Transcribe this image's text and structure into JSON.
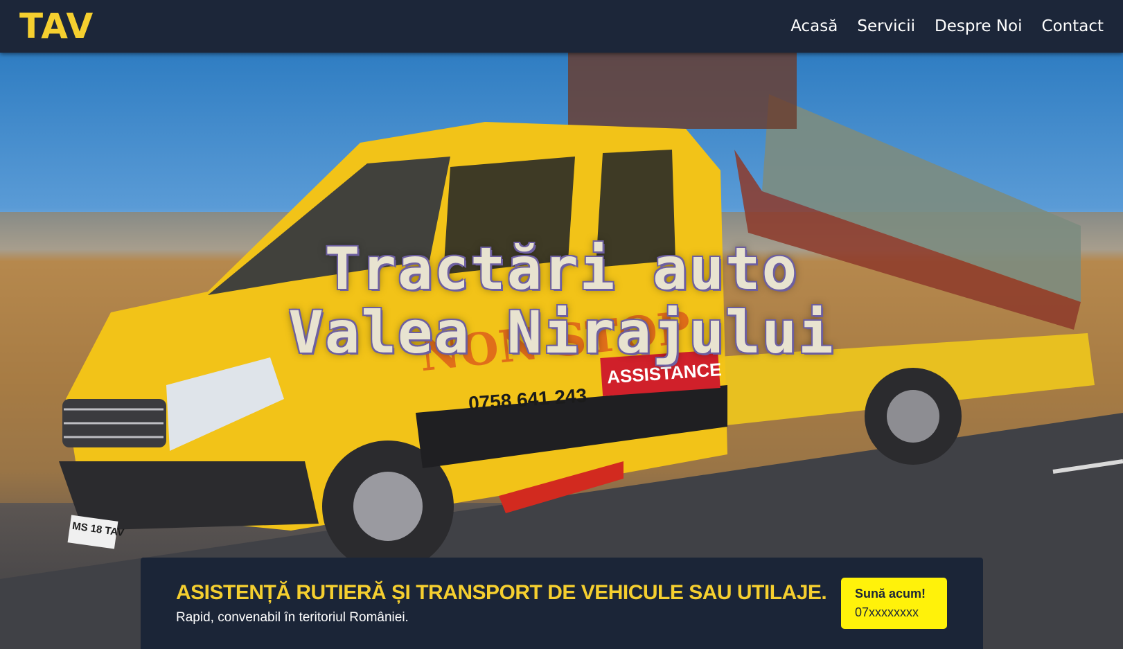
{
  "nav": {
    "logo": "TAV",
    "links": [
      "Acasă",
      "Servicii",
      "Despre Noi",
      "Contact"
    ]
  },
  "hero": {
    "title_line1": "Tractări auto",
    "title_line2": "Valea Nirajului",
    "truck_phone": "0758 641 243",
    "truck_badge": "ASSISTANCE",
    "truck_side_text": "NON STOP",
    "truck_plate": "MS 18 TAV"
  },
  "banner": {
    "headline": "ASISTENȚĂ RUTIERĂ ȘI TRANSPORT DE VEHICULE SAU UTILAJE.",
    "subtitle": "Rapid, convenabil în teritoriul României.",
    "cta_label": "Sună acum!",
    "cta_number": "07xxxxxxxx"
  },
  "colors": {
    "navbar_bg": "#1c2639",
    "accent_yellow": "#f5cf2f",
    "button_yellow": "#fff20a",
    "truck_yellow": "#f2c318"
  }
}
